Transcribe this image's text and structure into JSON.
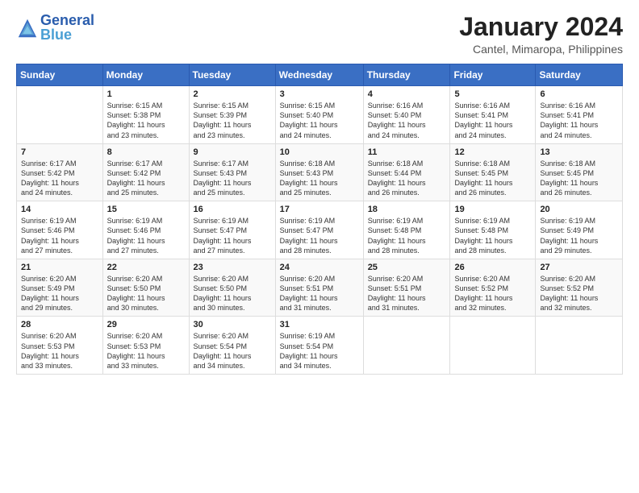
{
  "header": {
    "logo_line1": "General",
    "logo_line2": "Blue",
    "month_title": "January 2024",
    "location": "Cantel, Mimaropa, Philippines"
  },
  "days_of_week": [
    "Sunday",
    "Monday",
    "Tuesday",
    "Wednesday",
    "Thursday",
    "Friday",
    "Saturday"
  ],
  "weeks": [
    [
      {
        "day": "",
        "content": ""
      },
      {
        "day": "1",
        "content": "Sunrise: 6:15 AM\nSunset: 5:38 PM\nDaylight: 11 hours\nand 23 minutes."
      },
      {
        "day": "2",
        "content": "Sunrise: 6:15 AM\nSunset: 5:39 PM\nDaylight: 11 hours\nand 23 minutes."
      },
      {
        "day": "3",
        "content": "Sunrise: 6:15 AM\nSunset: 5:40 PM\nDaylight: 11 hours\nand 24 minutes."
      },
      {
        "day": "4",
        "content": "Sunrise: 6:16 AM\nSunset: 5:40 PM\nDaylight: 11 hours\nand 24 minutes."
      },
      {
        "day": "5",
        "content": "Sunrise: 6:16 AM\nSunset: 5:41 PM\nDaylight: 11 hours\nand 24 minutes."
      },
      {
        "day": "6",
        "content": "Sunrise: 6:16 AM\nSunset: 5:41 PM\nDaylight: 11 hours\nand 24 minutes."
      }
    ],
    [
      {
        "day": "7",
        "content": "Sunrise: 6:17 AM\nSunset: 5:42 PM\nDaylight: 11 hours\nand 24 minutes."
      },
      {
        "day": "8",
        "content": "Sunrise: 6:17 AM\nSunset: 5:42 PM\nDaylight: 11 hours\nand 25 minutes."
      },
      {
        "day": "9",
        "content": "Sunrise: 6:17 AM\nSunset: 5:43 PM\nDaylight: 11 hours\nand 25 minutes."
      },
      {
        "day": "10",
        "content": "Sunrise: 6:18 AM\nSunset: 5:43 PM\nDaylight: 11 hours\nand 25 minutes."
      },
      {
        "day": "11",
        "content": "Sunrise: 6:18 AM\nSunset: 5:44 PM\nDaylight: 11 hours\nand 26 minutes."
      },
      {
        "day": "12",
        "content": "Sunrise: 6:18 AM\nSunset: 5:45 PM\nDaylight: 11 hours\nand 26 minutes."
      },
      {
        "day": "13",
        "content": "Sunrise: 6:18 AM\nSunset: 5:45 PM\nDaylight: 11 hours\nand 26 minutes."
      }
    ],
    [
      {
        "day": "14",
        "content": "Sunrise: 6:19 AM\nSunset: 5:46 PM\nDaylight: 11 hours\nand 27 minutes."
      },
      {
        "day": "15",
        "content": "Sunrise: 6:19 AM\nSunset: 5:46 PM\nDaylight: 11 hours\nand 27 minutes."
      },
      {
        "day": "16",
        "content": "Sunrise: 6:19 AM\nSunset: 5:47 PM\nDaylight: 11 hours\nand 27 minutes."
      },
      {
        "day": "17",
        "content": "Sunrise: 6:19 AM\nSunset: 5:47 PM\nDaylight: 11 hours\nand 28 minutes."
      },
      {
        "day": "18",
        "content": "Sunrise: 6:19 AM\nSunset: 5:48 PM\nDaylight: 11 hours\nand 28 minutes."
      },
      {
        "day": "19",
        "content": "Sunrise: 6:19 AM\nSunset: 5:48 PM\nDaylight: 11 hours\nand 28 minutes."
      },
      {
        "day": "20",
        "content": "Sunrise: 6:19 AM\nSunset: 5:49 PM\nDaylight: 11 hours\nand 29 minutes."
      }
    ],
    [
      {
        "day": "21",
        "content": "Sunrise: 6:20 AM\nSunset: 5:49 PM\nDaylight: 11 hours\nand 29 minutes."
      },
      {
        "day": "22",
        "content": "Sunrise: 6:20 AM\nSunset: 5:50 PM\nDaylight: 11 hours\nand 30 minutes."
      },
      {
        "day": "23",
        "content": "Sunrise: 6:20 AM\nSunset: 5:50 PM\nDaylight: 11 hours\nand 30 minutes."
      },
      {
        "day": "24",
        "content": "Sunrise: 6:20 AM\nSunset: 5:51 PM\nDaylight: 11 hours\nand 31 minutes."
      },
      {
        "day": "25",
        "content": "Sunrise: 6:20 AM\nSunset: 5:51 PM\nDaylight: 11 hours\nand 31 minutes."
      },
      {
        "day": "26",
        "content": "Sunrise: 6:20 AM\nSunset: 5:52 PM\nDaylight: 11 hours\nand 32 minutes."
      },
      {
        "day": "27",
        "content": "Sunrise: 6:20 AM\nSunset: 5:52 PM\nDaylight: 11 hours\nand 32 minutes."
      }
    ],
    [
      {
        "day": "28",
        "content": "Sunrise: 6:20 AM\nSunset: 5:53 PM\nDaylight: 11 hours\nand 33 minutes."
      },
      {
        "day": "29",
        "content": "Sunrise: 6:20 AM\nSunset: 5:53 PM\nDaylight: 11 hours\nand 33 minutes."
      },
      {
        "day": "30",
        "content": "Sunrise: 6:20 AM\nSunset: 5:54 PM\nDaylight: 11 hours\nand 34 minutes."
      },
      {
        "day": "31",
        "content": "Sunrise: 6:19 AM\nSunset: 5:54 PM\nDaylight: 11 hours\nand 34 minutes."
      },
      {
        "day": "",
        "content": ""
      },
      {
        "day": "",
        "content": ""
      },
      {
        "day": "",
        "content": ""
      }
    ]
  ]
}
